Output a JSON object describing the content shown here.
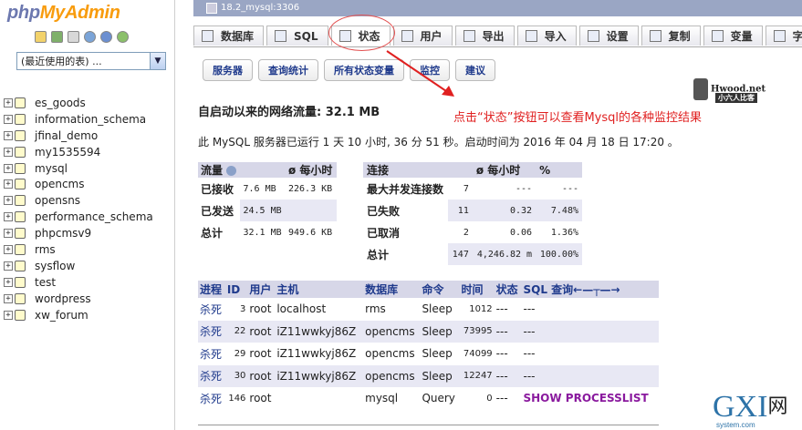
{
  "brand": {
    "php": "php",
    "myadmin": "MyAdmin"
  },
  "left_icons": [
    "home-icon",
    "exit-icon",
    "query-window-icon",
    "docs-icon",
    "help-icon",
    "reload-icon"
  ],
  "db_select": {
    "value": "(最近使用的表) ..."
  },
  "databases": [
    "es_goods",
    "information_schema",
    "jfinal_demo",
    "my1535594",
    "mysql",
    "opencms",
    "opensns",
    "performance_schema",
    "phpcmsv9",
    "rms",
    "sysflow",
    "test",
    "wordpress",
    "xw_forum"
  ],
  "server_bar": {
    "title": "18.2_mysql:3306"
  },
  "tabs": [
    {
      "label": "数据库",
      "icon": "database-icon"
    },
    {
      "label": "SQL",
      "icon": "sql-icon"
    },
    {
      "label": "状态",
      "icon": "status-icon"
    },
    {
      "label": "用户",
      "icon": "users-icon"
    },
    {
      "label": "导出",
      "icon": "export-icon"
    },
    {
      "label": "导入",
      "icon": "import-icon"
    },
    {
      "label": "设置",
      "icon": "settings-icon"
    },
    {
      "label": "复制",
      "icon": "replication-icon"
    },
    {
      "label": "变量",
      "icon": "variables-icon"
    },
    {
      "label": "字",
      "icon": "charset-icon"
    }
  ],
  "subtabs": [
    "服务器",
    "查询统计",
    "所有状态变量",
    "监控",
    "建议"
  ],
  "annotation": "点击“状态”按钮可以查看Mysql的各种监控结果",
  "watermark": {
    "title": "Hwood.net",
    "sub": "小六人比客"
  },
  "traffic_title": "自启动以来的网络流量: 32.1 MB",
  "uptime_text": "此 MySQL 服务器已运行 1 天 10 小时, 36 分 51 秒。启动时间为 2016 年 04 月 18 日 17:20 。",
  "traffic_table": {
    "headers": [
      "流量",
      "ø 每小时"
    ],
    "rows": [
      {
        "label": "已接收",
        "value": "7.6 MB",
        "per_hour": "226.3 KB"
      },
      {
        "label": "已发送",
        "value": "24.5 MB",
        "per_hour": ""
      },
      {
        "label": "总计",
        "value": "32.1 MB",
        "per_hour": "949.6 KB"
      }
    ]
  },
  "connections_table": {
    "headers": [
      "连接",
      "",
      "ø 每小时",
      "%"
    ],
    "rows": [
      {
        "label": "最大并发连接数",
        "value": "7",
        "per_hour": "---",
        "pct": "---"
      },
      {
        "label": "已失败",
        "value": "11",
        "per_hour": "0.32",
        "pct": "7.48%"
      },
      {
        "label": "已取消",
        "value": "2",
        "per_hour": "0.06",
        "pct": "1.36%"
      },
      {
        "label": "总计",
        "value": "147",
        "per_hour": "4,246.82 m",
        "pct": "100.00%"
      }
    ]
  },
  "process_table": {
    "headers": [
      "进程",
      "ID",
      "用户",
      "主机",
      "数据库",
      "命令",
      "时间",
      "状态",
      "SQL 查询←—┬—→"
    ],
    "rows": [
      {
        "kill": "杀死",
        "id": "3",
        "user": "root",
        "host": "localhost",
        "db": "rms",
        "command": "Sleep",
        "time": "1012",
        "state": "---",
        "sql": "---"
      },
      {
        "kill": "杀死",
        "id": "22",
        "user": "root",
        "host": "iZ11wwkyj86Z",
        "db": "opencms",
        "command": "Sleep",
        "time": "73995",
        "state": "---",
        "sql": "---"
      },
      {
        "kill": "杀死",
        "id": "29",
        "user": "root",
        "host": "iZ11wwkyj86Z",
        "db": "opencms",
        "command": "Sleep",
        "time": "74099",
        "state": "---",
        "sql": "---"
      },
      {
        "kill": "杀死",
        "id": "30",
        "user": "root",
        "host": "iZ11wwkyj86Z",
        "db": "opencms",
        "command": "Sleep",
        "time": "12247",
        "state": "---",
        "sql": "---"
      },
      {
        "kill": "杀死",
        "id": "146",
        "user": "root",
        "host": "",
        "db": "mysql",
        "command": "Query",
        "time": "0",
        "state": "---",
        "sql": "SHOW PROCESSLIST"
      }
    ]
  },
  "site_logo": {
    "main": "GXI",
    "net": "网",
    "sub": "system.com"
  },
  "colors": {
    "annotation_red": "#e02020",
    "link_blue": "#1f3a8c",
    "header_bg": "#d7d7e8",
    "row_alt": "#e8e8f4"
  }
}
